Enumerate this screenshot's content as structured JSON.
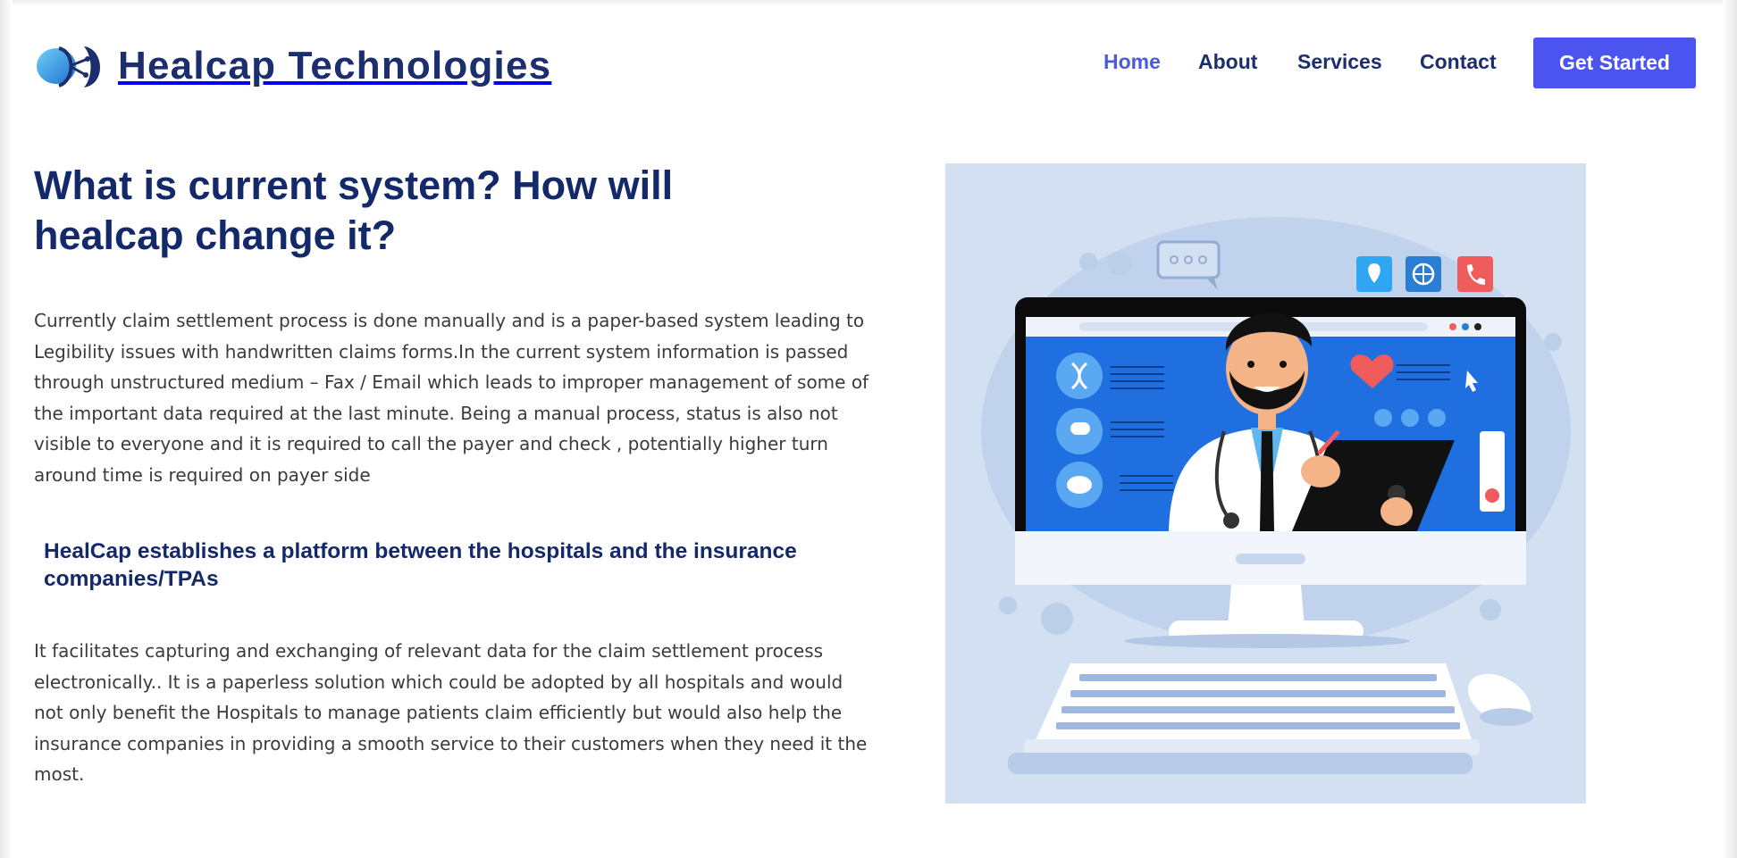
{
  "brand": {
    "name": "Healcap Technologies",
    "logo_icon": "globe-logo-icon"
  },
  "nav": {
    "items": [
      {
        "label": "Home",
        "active": true
      },
      {
        "label": "About",
        "active": false
      },
      {
        "label": "Services",
        "active": false
      },
      {
        "label": "Contact",
        "active": false
      }
    ],
    "cta_label": "Get Started"
  },
  "main": {
    "title": "What is current system? How will healcap change it?",
    "intro": "Currently claim settlement process is done manually and is a paper-based system leading to Legibility issues with handwritten claims forms.In the current system information is passed through unstructured medium – Fax / Email which leads to improper management of some of the important data required at the last minute. Being a manual process, status is also not visible to everyone and it is required to call the payer and check , potentially higher turn around time is required on payer side",
    "subheading": "HealCap establishes a platform between the hospitals and the insurance companies/TPAs",
    "body": "It facilitates capturing and exchanging of relevant data for the claim settlement process electronically.. It is a paperless solution which could be adopted by all hospitals and would not only benefit the Hospitals to manage patients claim efficiently but would also help the insurance companies in providing a smooth service to their customers when they need it the most.",
    "illustration": "doctor-on-computer-illustration"
  },
  "colors": {
    "accent": "#4c54ef",
    "heading": "#14296a",
    "nav_active": "#4c5bdc",
    "body_text": "#3b3b3b",
    "illustration_bg": "#d3e0f2"
  }
}
